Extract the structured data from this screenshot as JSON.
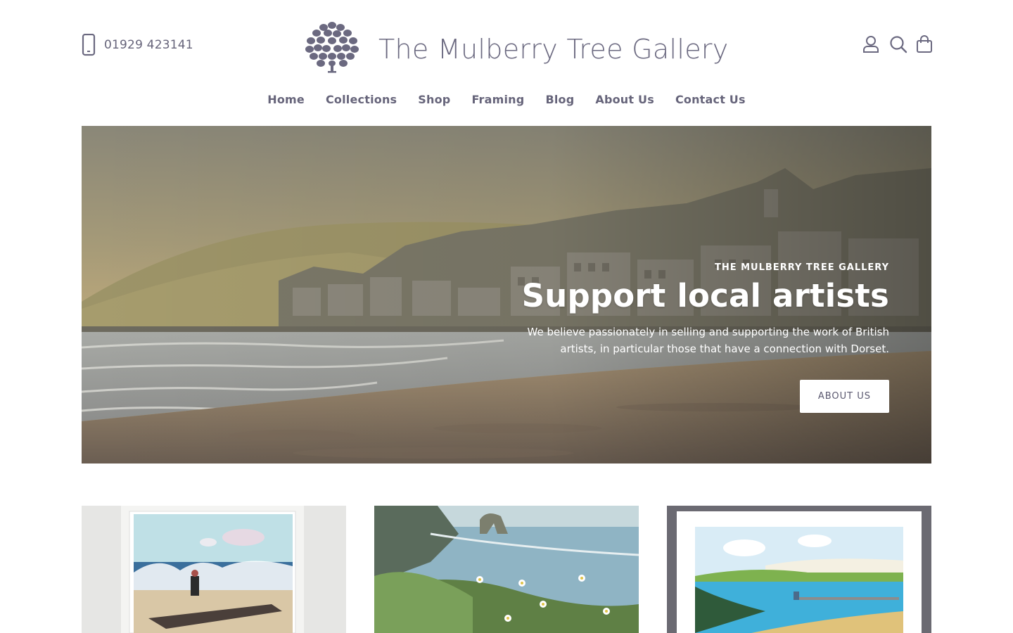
{
  "header": {
    "phone": "01929 423141",
    "logo_text": "The Mulberry Tree Gallery",
    "icons": [
      "account-icon",
      "search-icon",
      "cart-icon"
    ]
  },
  "nav": {
    "items": [
      {
        "label": "Home"
      },
      {
        "label": "Collections"
      },
      {
        "label": "Shop"
      },
      {
        "label": "Framing"
      },
      {
        "label": "Blog"
      },
      {
        "label": "About Us"
      },
      {
        "label": "Contact Us"
      }
    ]
  },
  "hero": {
    "eyebrow": "THE MULBERRY TREE GALLERY",
    "title": "Support local artists",
    "text": "We believe passionately in selling and supporting the work of British artists, in particular those that have a connection with Dorset.",
    "button_label": "ABOUT US"
  },
  "colors": {
    "brand": "#6b6980",
    "nav_text": "#66647a",
    "hero_text": "#ffffff"
  }
}
